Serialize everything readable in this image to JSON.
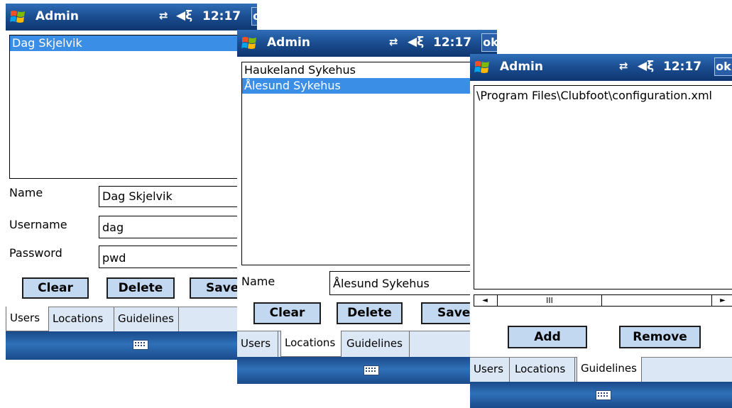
{
  "status_bar": {
    "title": "Admin",
    "time": "12:17",
    "ok_label": "ok"
  },
  "tabs": [
    "Users",
    "Locations",
    "Guidelines"
  ],
  "users_window": {
    "list": [
      "Dag Skjelvik"
    ],
    "fields": [
      {
        "label": "Name",
        "value": "Dag Skjelvik"
      },
      {
        "label": "Username",
        "value": "dag"
      },
      {
        "label": "Password",
        "value": "pwd"
      }
    ],
    "buttons": {
      "clear": "Clear",
      "delete": "Delete",
      "save": "Save"
    },
    "active_tab": "Users"
  },
  "locations_window": {
    "list": [
      "Haukeland Sykehus",
      "Ålesund Sykehus"
    ],
    "selected_index": 1,
    "fields": [
      {
        "label": "Name",
        "value": "Ålesund Sykehus"
      }
    ],
    "buttons": {
      "clear": "Clear",
      "delete": "Delete",
      "save": "Save"
    },
    "active_tab": "Locations"
  },
  "guidelines_window": {
    "list": [
      "\\Program Files\\Clubfoot\\configuration.xml"
    ],
    "scrollbar": {
      "left_arrow": "◄",
      "thumb": "III",
      "right_arrow": "►"
    },
    "buttons": {
      "add": "Add",
      "remove": "Remove"
    },
    "active_tab": "Guidelines"
  },
  "colors": {
    "titlebar": "#1c4f93",
    "selection": "#3a8ee6",
    "button_face": "#c2d8f1",
    "tab_bar": "#dce7f5"
  },
  "icons": [
    "windows-start-icon",
    "connectivity-icon",
    "speaker-icon",
    "keyboard-icon"
  ]
}
